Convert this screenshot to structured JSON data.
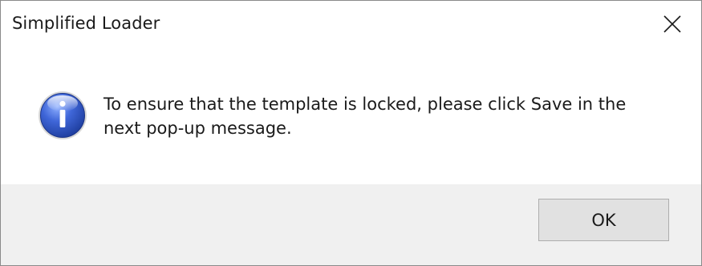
{
  "window": {
    "title": "Simplified Loader",
    "close_icon": "close-icon"
  },
  "content": {
    "icon": "info-icon",
    "message": "To ensure that the template is locked, please click Save in the next pop-up message."
  },
  "footer": {
    "ok_label": "OK"
  },
  "colors": {
    "footer_bg": "#f0f0f0",
    "button_bg": "#e1e1e1",
    "button_border": "#adadad",
    "icon_blue": "#2b50b8"
  }
}
